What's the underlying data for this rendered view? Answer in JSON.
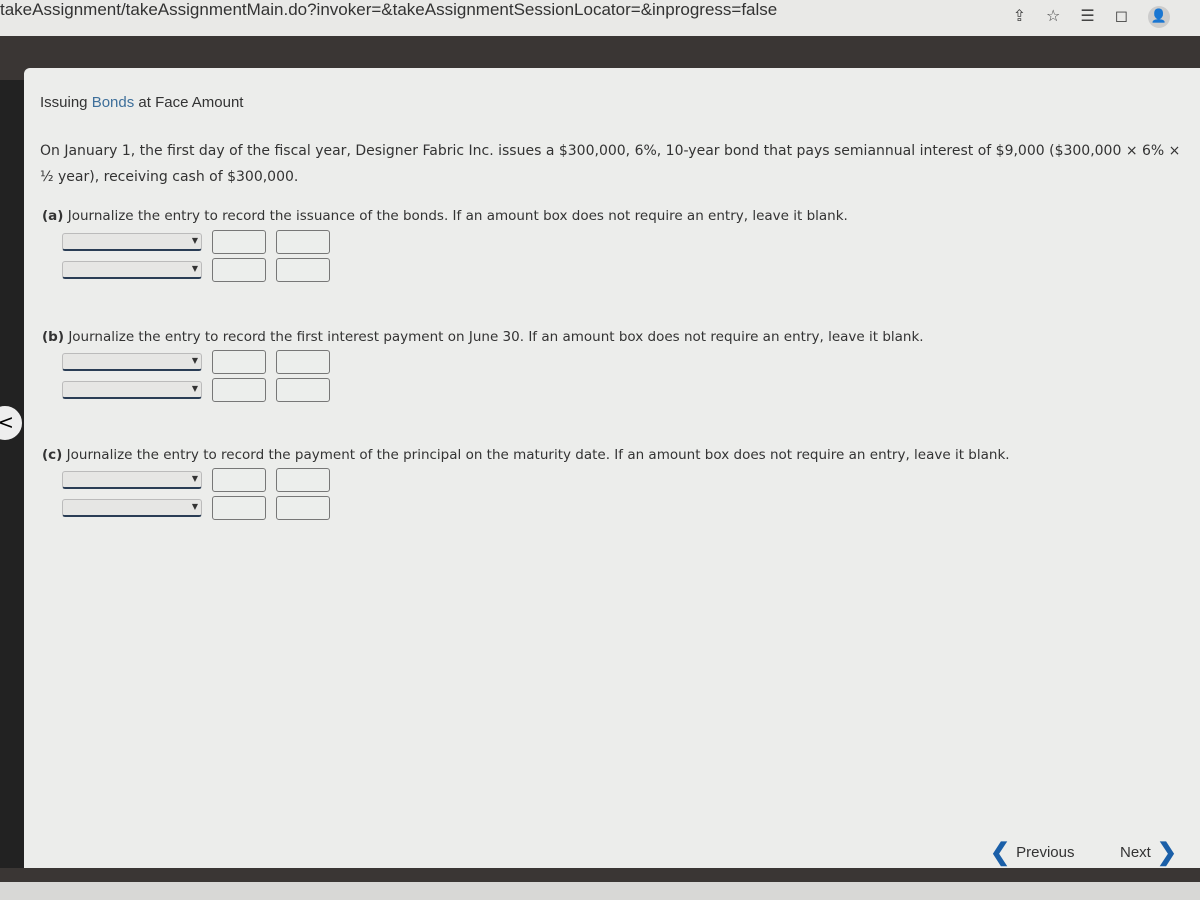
{
  "browser": {
    "url": "takeAssignment/takeAssignmentMain.do?invoker=&takeAssignmentSessionLocator=&inprogress=false"
  },
  "title": {
    "prefix": "Issuing ",
    "keyword": "Bonds",
    "suffix": " at Face Amount"
  },
  "problem": "On January 1, the first day of the fiscal year, Designer Fabric Inc. issues a $300,000, 6%, 10-year bond that pays semiannual interest of $9,000 ($300,000 × 6% × ½ year), receiving cash of $300,000.",
  "questions": [
    {
      "label": "(a)",
      "text": "Journalize the entry to record the issuance of the bonds. If an amount box does not require an entry, leave it blank."
    },
    {
      "label": "(b)",
      "text": "Journalize the entry to record the first interest payment on June 30. If an amount box does not require an entry, leave it blank."
    },
    {
      "label": "(c)",
      "text": "Journalize the entry to record the payment of the principal on the maturity date. If an amount box does not require an entry, leave it blank."
    }
  ],
  "nav": {
    "previous": "Previous",
    "next": "Next"
  },
  "colors": {
    "link": "#3e6f9a",
    "nav_chevron": "#1a5fa8"
  }
}
